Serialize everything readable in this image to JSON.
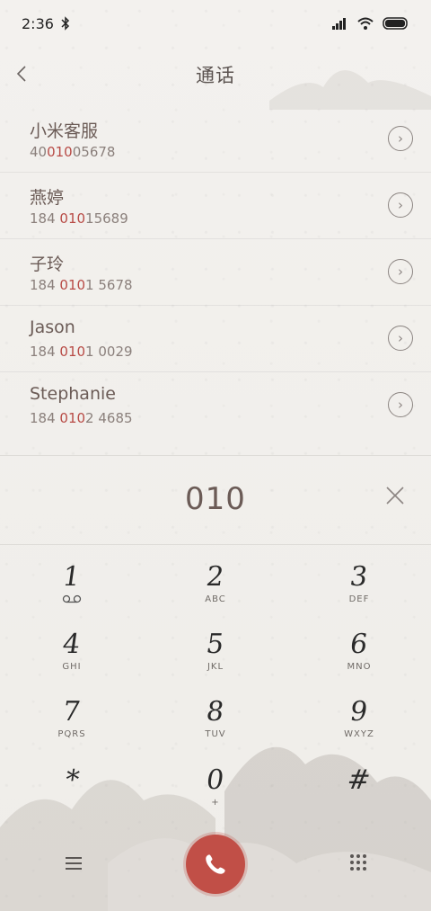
{
  "status": {
    "time": "2:36",
    "bluetooth_icon": "bluetooth-icon",
    "signal_icon": "signal-icon",
    "wifi_icon": "wifi-icon",
    "battery_icon": "battery-icon"
  },
  "header": {
    "title": "通话",
    "back_icon": "chevron-left-icon"
  },
  "contacts": [
    {
      "name": "小米客服",
      "pre": "40",
      "hl": "010",
      "post": "05678"
    },
    {
      "name": "燕婷",
      "pre": "184 ",
      "hl": "010",
      "post": "15689"
    },
    {
      "name": "子玲",
      "pre": "184 ",
      "hl": "010",
      "post": "1 5678"
    },
    {
      "name": "Jason",
      "pre": "184 ",
      "hl": "010",
      "post": "1 0029"
    },
    {
      "name": "Stephanie",
      "pre": "184 ",
      "hl": "010",
      "post": "2 4685"
    }
  ],
  "dialer": {
    "number": "010",
    "clear_icon": "close-icon"
  },
  "keys": [
    {
      "digit": "1",
      "letters": ""
    },
    {
      "digit": "2",
      "letters": "ABC"
    },
    {
      "digit": "3",
      "letters": "DEF"
    },
    {
      "digit": "4",
      "letters": "GHI"
    },
    {
      "digit": "5",
      "letters": "JKL"
    },
    {
      "digit": "6",
      "letters": "MNO"
    },
    {
      "digit": "7",
      "letters": "PQRS"
    },
    {
      "digit": "8",
      "letters": "TUV"
    },
    {
      "digit": "9",
      "letters": "WXYZ"
    },
    {
      "digit": "*",
      "letters": ""
    },
    {
      "digit": "0",
      "letters": "+"
    },
    {
      "digit": "#",
      "letters": ""
    }
  ],
  "bottom": {
    "menu_icon": "menu-icon",
    "call_icon": "phone-icon",
    "keypad_icon": "keypad-grid-icon"
  },
  "colors": {
    "accent": "#c14f47",
    "highlight": "#b84b46",
    "background": "#f1efec"
  }
}
